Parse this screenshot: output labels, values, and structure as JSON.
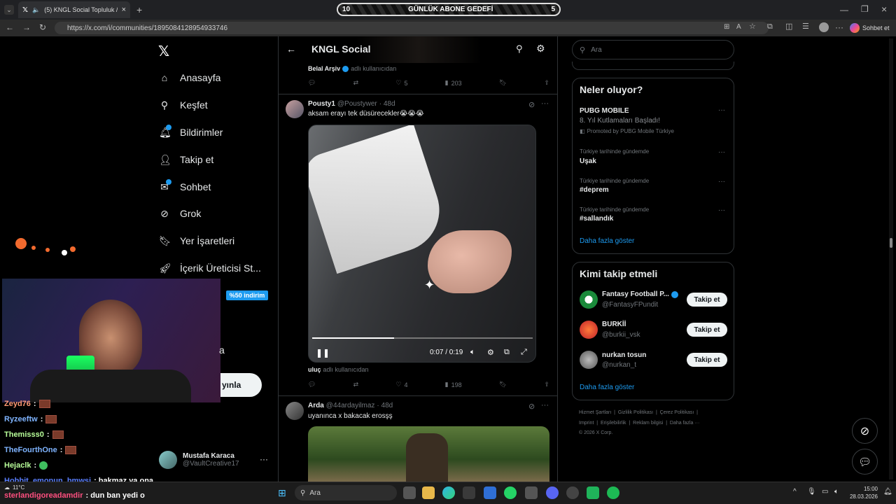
{
  "browser": {
    "tab_title": "(5) KNGL Social Topluluk / X",
    "url": "https://x.com/i/communities/1895084128954933746",
    "chat_button": "Sohbet et"
  },
  "overlay": {
    "goal_left": "10",
    "goal_title": "GÜNLÜK ABONE GEDEFİ",
    "goal_right": "5",
    "discount": "%50 indirim",
    "chat": [
      {
        "user": "Zeyd76",
        "text": ":"
      },
      {
        "user": "Ryzeeftw",
        "text": ":"
      },
      {
        "user": "Themisss0",
        "text": ":"
      },
      {
        "user": "TheFourthOne",
        "text": ":"
      },
      {
        "user": "Hejaclk",
        "text": ":"
      },
      {
        "user": "Hobbit_emonun_bmwsi",
        "text": ": bakmaz ya ona"
      },
      {
        "user": "sterlandigoreadamdir",
        "text": ": dun ban yedi o"
      }
    ],
    "partial_a": "a",
    "partial_post": "yınla"
  },
  "nav": {
    "items": [
      {
        "label": "Anasayfa",
        "icon": "home-icon"
      },
      {
        "label": "Keşfet",
        "icon": "search-icon"
      },
      {
        "label": "Bildirimler",
        "icon": "bell-icon"
      },
      {
        "label": "Takip et",
        "icon": "follow-icon"
      },
      {
        "label": "Sohbet",
        "icon": "mail-icon"
      },
      {
        "label": "Grok",
        "icon": "grok-icon"
      },
      {
        "label": "Yer İşaretleri",
        "icon": "bookmark-icon"
      },
      {
        "label": "İçerik Üreticisi St...",
        "icon": "rocket-icon"
      }
    ],
    "account_name": "Mustafa Karaca",
    "account_handle": "@VaultCreative17"
  },
  "main": {
    "title": "KNGL Social",
    "top_post": {
      "source": "Belal Arşiv",
      "source_suffix": "adlı kullanıcıdan",
      "likes": "5",
      "views": "203"
    },
    "post1": {
      "name": "Pousty1",
      "handle": "@Poustywer",
      "time": "· 48d",
      "text": "aksam erayı tek düsürecekler😭😭😭",
      "video_time": "0:07 / 0:19",
      "source": "uluç",
      "source_suffix": "adlı kullanıcıdan",
      "likes": "4",
      "views": "198",
      "video_progress": 0.37
    },
    "post2": {
      "name": "Arda",
      "handle": "@44ardayilmaz",
      "time": "· 48d",
      "text": "uyanınca x bakacak erosşş"
    }
  },
  "right": {
    "search_placeholder": "Ara",
    "trends_title": "Neler oluyor?",
    "promo_title": "PUBG MOBILE",
    "promo_sub": "8. Yıl Kutlamaları Başladı!",
    "promo_by": "Promoted by PUBG Mobile Türkiye",
    "trends": [
      {
        "context": "Türkiye tarihinde gündemde",
        "name": "Uşak"
      },
      {
        "context": "Türkiye tarihinde gündemde",
        "name": "#deprem"
      },
      {
        "context": "Türkiye tarihinde gündemde",
        "name": "#sallandık"
      }
    ],
    "show_more": "Daha fazla göster",
    "who_title": "Kimi takip etmeli",
    "who": [
      {
        "name": "Fantasy Football P...",
        "handle": "@FantasyFPundit"
      },
      {
        "name": "BURKİİ",
        "handle": "@burkii_vsk"
      },
      {
        "name": "nurkan tosun",
        "handle": "@nurkan_t"
      }
    ],
    "follow_label": "Takip et",
    "footer_line1": "Hizmet Şartları  |  Gizlilik Politikası  |  Çerez Politikası  |",
    "footer_line2": "Imprint  |  Erişilebilirlik  |  Reklam bilgisi  |  Daha fazla ···",
    "footer_line3": "© 2026 X Corp."
  },
  "taskbar": {
    "search": "Ara",
    "weather": "11°C",
    "time": "15:00",
    "date": "28.03.2026"
  }
}
